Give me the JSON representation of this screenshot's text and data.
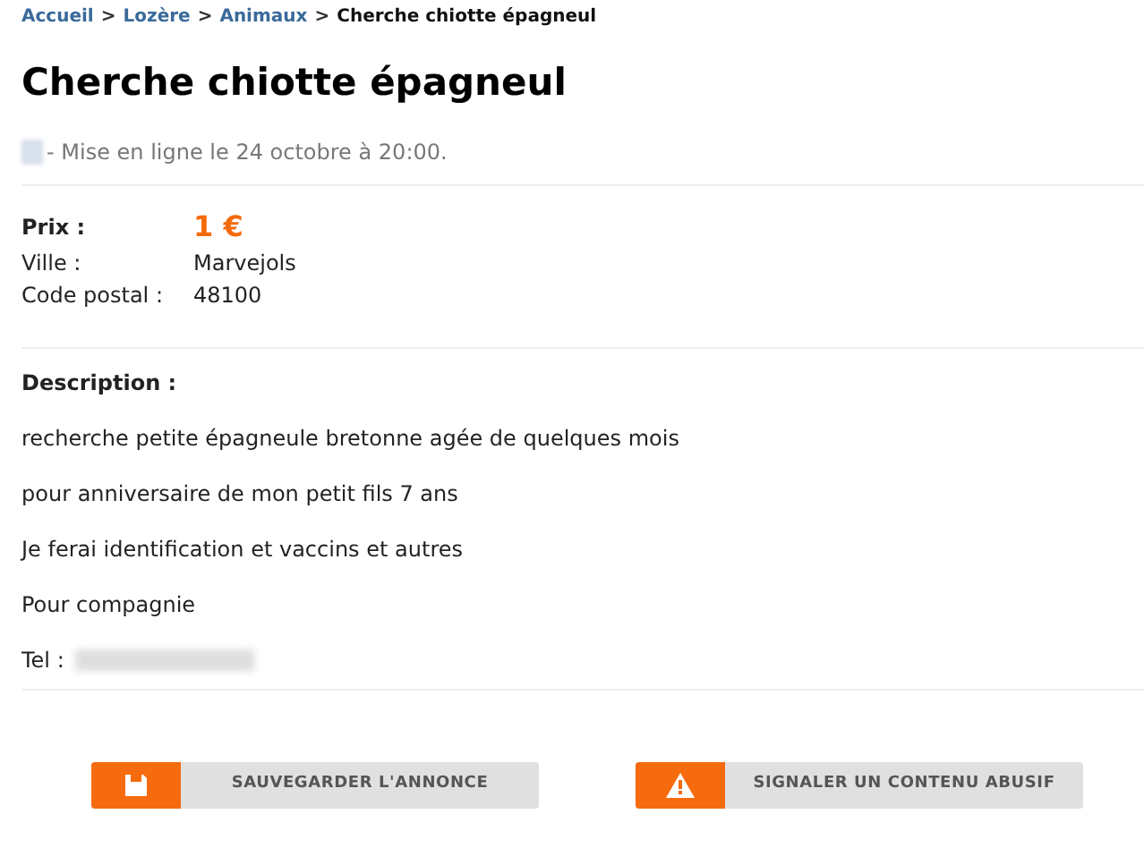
{
  "breadcrumb": [
    {
      "label": "Accueil",
      "kind": "link"
    },
    {
      "label": "Lozère",
      "kind": "link"
    },
    {
      "label": "Animaux",
      "kind": "link"
    },
    {
      "label": "Cherche chiotte épagneul",
      "kind": "current"
    }
  ],
  "breadcrumb_separator": ">",
  "title": "Cherche chiotte épagneul",
  "posted": "- Mise en ligne le 24 octobre à 20:00.",
  "details": [
    {
      "label": "Prix :",
      "value": "1 €",
      "kind": "price"
    },
    {
      "label": "Ville :",
      "value": "Marvejols",
      "kind": "plain"
    },
    {
      "label": "Code postal :",
      "value": "48100",
      "kind": "plain"
    }
  ],
  "description": {
    "heading": "Description :",
    "lines": [
      "recherche petite épagneule bretonne agée de quelques mois",
      "pour anniversaire de mon petit fils 7 ans",
      "Je ferai identification et vaccins et autres",
      "Pour compagnie"
    ],
    "phone_label": "Tel :"
  },
  "actions": [
    {
      "label": "SAUVEGARDER L'ANNONCE",
      "kind": "save"
    },
    {
      "label": "SIGNALER UN CONTENU ABUSIF",
      "kind": "report"
    }
  ]
}
